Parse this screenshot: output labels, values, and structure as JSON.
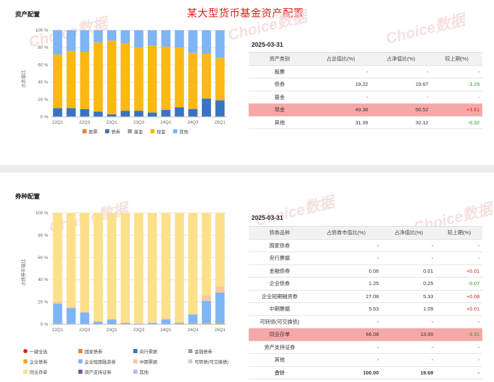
{
  "page_title": "某大型货币基金资产配置",
  "watermark": "Choice数据",
  "asset": {
    "section_title": "资产配置",
    "ylabel": "占总值比",
    "date": "2025-03-31",
    "columns": [
      "资产类别",
      "占总值比(%)",
      "占净值比(%)",
      "较上期(%)"
    ],
    "rows": [
      {
        "name": "股票",
        "total": "-",
        "net": "-",
        "change": "-",
        "trend": "none",
        "highlight": false
      },
      {
        "name": "债券",
        "total": "19.22",
        "net": "19.67",
        "change": "-3.29",
        "trend": "neg",
        "highlight": false
      },
      {
        "name": "基金",
        "total": "-",
        "net": "-",
        "change": "-",
        "trend": "none",
        "highlight": false
      },
      {
        "name": "现金",
        "total": "49.38",
        "net": "50.52",
        "change": "+3.61",
        "trend": "pos",
        "highlight": true
      },
      {
        "name": "其他",
        "total": "31.39",
        "net": "32.12",
        "change": "-0.32",
        "trend": "neg",
        "highlight": false
      }
    ]
  },
  "bond": {
    "section_title": "券种配置",
    "ylabel": "占债券市值比",
    "date": "2025-03-31",
    "columns": [
      "债券品种",
      "占债券市值比(%)",
      "占净值比(%)",
      "较上期(%)"
    ],
    "rows": [
      {
        "name": "国家债券",
        "mv": "-",
        "net": "-",
        "change": "-",
        "trend": "none",
        "highlight": false
      },
      {
        "name": "央行票据",
        "mv": "-",
        "net": "-",
        "change": "-",
        "trend": "none",
        "highlight": false
      },
      {
        "name": "金融债券",
        "mv": "0.06",
        "net": "0.01",
        "change": "+0.01",
        "trend": "pos",
        "highlight": false
      },
      {
        "name": "企业债券",
        "mv": "1.25",
        "net": "0.25",
        "change": "-0.07",
        "trend": "neg",
        "highlight": false
      },
      {
        "name": "企业短期融资券",
        "mv": "27.08",
        "net": "5.33",
        "change": "+0.08",
        "trend": "pos",
        "highlight": false
      },
      {
        "name": "中期票据",
        "mv": "5.53",
        "net": "1.09",
        "change": "+0.01",
        "trend": "pos",
        "highlight": false
      },
      {
        "name": "可转债(可交换债)",
        "mv": "-",
        "net": "-",
        "change": "-",
        "trend": "none",
        "highlight": false
      },
      {
        "name": "同业存单",
        "mv": "66.08",
        "net": "13.00",
        "change": "-3.31",
        "trend": "neg",
        "highlight": true
      },
      {
        "name": "资产支持证券",
        "mv": "-",
        "net": "-",
        "change": "-",
        "trend": "none",
        "highlight": false
      },
      {
        "name": "其他",
        "mv": "-",
        "net": "-",
        "change": "-",
        "trend": "none",
        "highlight": false
      },
      {
        "name": "合计",
        "mv": "100.00",
        "net": "19.68",
        "change": "-",
        "trend": "none",
        "highlight": false,
        "bold": true
      }
    ],
    "select_all_label": "一键全选"
  },
  "chart_data": [
    {
      "type": "bar",
      "stacked": true,
      "categories": [
        "22Q1",
        "22Q2",
        "22Q3",
        "22Q4",
        "23Q1",
        "23Q2",
        "23Q3",
        "23Q4",
        "24Q1",
        "24Q2",
        "24Q3",
        "24Q4",
        "25Q1"
      ],
      "tick_labels": [
        "22Q1",
        "22Q3",
        "23Q1",
        "23Q3",
        "24Q1",
        "24Q3",
        "25Q1"
      ],
      "y_ticks": [
        "0 %",
        "20 %",
        "40 %",
        "60 %",
        "80 %",
        "100 %"
      ],
      "ylim": [
        0,
        100
      ],
      "ylabel": "占总值比",
      "legend_position": "bottom",
      "series": [
        {
          "name": "股票",
          "color": "#f07f35",
          "values": [
            0,
            0,
            0,
            0,
            0,
            0,
            0,
            0,
            0,
            0,
            0,
            0,
            0
          ]
        },
        {
          "name": "债券",
          "color": "#3a73c5",
          "values": [
            10,
            10,
            9,
            6,
            3,
            7,
            7,
            5,
            8,
            11,
            9,
            21,
            19
          ]
        },
        {
          "name": "基金",
          "color": "#a0a0a0",
          "values": [
            0,
            0,
            0,
            0,
            0,
            0,
            0,
            0,
            0,
            0,
            0,
            0,
            0
          ]
        },
        {
          "name": "现金",
          "color": "#fcb813",
          "values": [
            62,
            66,
            66,
            80,
            85,
            78,
            73,
            77,
            73,
            69,
            65,
            52,
            49
          ]
        },
        {
          "name": "其他",
          "color": "#7eb5f5",
          "values": [
            28,
            24,
            25,
            14,
            12,
            15,
            20,
            18,
            19,
            20,
            26,
            27,
            32
          ]
        }
      ]
    },
    {
      "type": "bar",
      "stacked": true,
      "categories": [
        "22Q1",
        "22Q2",
        "22Q3",
        "22Q4",
        "23Q1",
        "23Q2",
        "23Q3",
        "23Q4",
        "24Q1",
        "24Q2",
        "24Q3",
        "24Q4",
        "25Q1"
      ],
      "tick_labels": [
        "22Q1",
        "22Q3",
        "23Q1",
        "23Q3",
        "24Q1",
        "24Q3",
        "25Q1"
      ],
      "y_ticks": [
        "0 %",
        "20 %",
        "40 %",
        "60 %",
        "80 %",
        "100 %"
      ],
      "ylim": [
        0,
        100
      ],
      "ylabel": "占债券市值比",
      "legend_position": "bottom",
      "series": [
        {
          "name": "国家债券",
          "color": "#f07f35",
          "values": [
            0,
            0,
            0,
            0,
            0,
            0,
            0,
            0,
            0,
            0,
            0,
            0,
            0
          ]
        },
        {
          "name": "央行票据",
          "color": "#3a73c5",
          "values": [
            0,
            0,
            0,
            0,
            0,
            0,
            0,
            0,
            0,
            0,
            0,
            0,
            0
          ]
        },
        {
          "name": "金融债券",
          "color": "#a0a0a0",
          "values": [
            0,
            0,
            0,
            0,
            0,
            0,
            0,
            0,
            0,
            0,
            0,
            0,
            0.06
          ]
        },
        {
          "name": "企业债券",
          "color": "#f5a623",
          "values": [
            0.5,
            0.5,
            0.5,
            0.3,
            0.3,
            0.2,
            0.2,
            0.2,
            0.3,
            0.3,
            0.8,
            1.0,
            1.25
          ]
        },
        {
          "name": "企业短期融资券",
          "color": "#7eb5f5",
          "values": [
            18,
            14,
            10,
            2,
            4,
            1,
            0.5,
            1,
            4,
            1,
            8,
            20,
            27.08
          ]
        },
        {
          "name": "中期票据",
          "color": "#f9c9a0",
          "values": [
            2,
            1,
            1,
            0.5,
            0.5,
            0.5,
            0.3,
            0.5,
            1,
            0.5,
            1,
            5,
            5.53
          ]
        },
        {
          "name": "可转债(可交换债)",
          "color": "#d0d0d0",
          "values": [
            0,
            0,
            0,
            0,
            0,
            0,
            0,
            0,
            0,
            0,
            0,
            0,
            0
          ]
        },
        {
          "name": "同业存单",
          "color": "#fde08a",
          "values": [
            79.5,
            84.5,
            88.5,
            97.2,
            95.2,
            98.3,
            99,
            98.3,
            94.7,
            98.2,
            90.2,
            74,
            66.08
          ]
        },
        {
          "name": "资产支持证券",
          "color": "#7b4fa8",
          "values": [
            0,
            0,
            0,
            0,
            0,
            0,
            0,
            0,
            0,
            0,
            0,
            0,
            0
          ]
        },
        {
          "name": "其他",
          "color": "#c9b3e6",
          "values": [
            0,
            0,
            0,
            0,
            0,
            0,
            0,
            0,
            0,
            0,
            0,
            0,
            0
          ]
        }
      ]
    }
  ]
}
